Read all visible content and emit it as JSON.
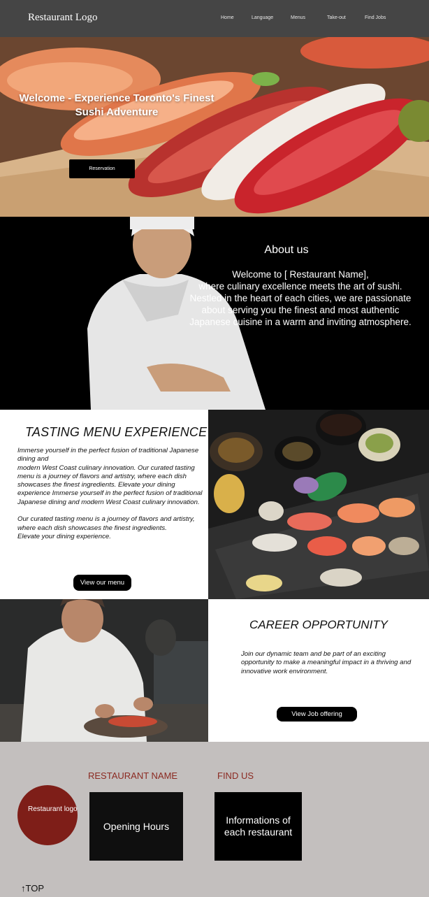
{
  "nav": {
    "logo": "Restaurant Logo",
    "items": [
      "Home",
      "Language",
      "Menus",
      "Take-out",
      "Find Jobs"
    ]
  },
  "hero": {
    "title": "Welcome - Experience Toronto's Finest Sushi Adventure",
    "reservation_label": "Reservation"
  },
  "about": {
    "title": "About us",
    "text": "Welcome to [ Restaurant Name],\nwhere culinary excellence meets the art of sushi.\n Nestled in the heart of each cities, we are passionate\nabout serving you the finest and most authentic\nJapanese cuisine in a warm and inviting atmosphere."
  },
  "tasting": {
    "title": "TASTING MENU EXPERIENCE",
    "text": "Immerse yourself in the perfect fusion of traditional Japanese dining and\nmodern West Coast culinary innovation. Our curated tasting menu is a journey of flavors and artistry, where each dish showcases the finest ingredients. Elevate your dining experience Immerse yourself in the perfect fusion of traditional Japanese dining and modern West Coast culinary innovation.\n\nOur curated tasting menu is a journey of flavors and artistry, where each dish showcases the finest ingredients.\nElevate your dining experience.",
    "button_label": "View our menu"
  },
  "career": {
    "title": "CAREER OPPORTUNITY",
    "text": "Join our dynamic team and be part of an exciting opportunity to make a meaningful impact in a thriving and innovative work environment.",
    "button_label": "View Job offering"
  },
  "footer": {
    "restaurant_name": "RESTAURANT NAME",
    "find_us": "FIND US",
    "logo_text": "Restaurant logo",
    "opening_hours": "Opening Hours",
    "info": "Informations   of\neach restaurant",
    "top_label": "↑TOP"
  },
  "colors": {
    "nav_bg": "#454545",
    "accent_red": "#8b2a22",
    "logo_circle": "#7e1e18",
    "footer_bg": "#c3bfbe"
  }
}
